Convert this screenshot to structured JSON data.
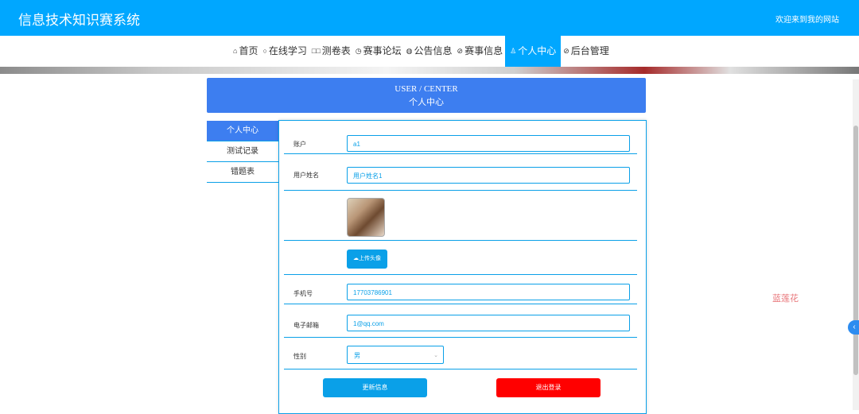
{
  "header": {
    "title": "信息技术知识赛系统",
    "welcome": "欢迎来到我的网站"
  },
  "nav": [
    {
      "icon": "⌂",
      "label": "首页",
      "active": false
    },
    {
      "icon": "○",
      "label": "在线学习",
      "active": false
    },
    {
      "icon": "□□",
      "label": "测卷表",
      "active": false
    },
    {
      "icon": "◷",
      "label": "赛事论坛",
      "active": false
    },
    {
      "icon": "◍",
      "label": "公告信息",
      "active": false
    },
    {
      "icon": "⊘",
      "label": "赛事信息",
      "active": false
    },
    {
      "icon": "♙",
      "label": "个人中心",
      "active": true
    },
    {
      "icon": "⊘",
      "label": "后台管理",
      "active": false
    }
  ],
  "page_header": {
    "en": "USER / CENTER",
    "cn": "个人中心"
  },
  "sidemenu": [
    {
      "label": "个人中心",
      "active": true
    },
    {
      "label": "测试记录",
      "active": false
    },
    {
      "label": "错题表",
      "active": false
    }
  ],
  "form": {
    "account": {
      "label": "账户",
      "value": "a1"
    },
    "name": {
      "label": "用户姓名",
      "value": "用户姓名1"
    },
    "upload_label": "上传头像",
    "phone": {
      "label": "手机号",
      "value": "17703786901"
    },
    "email": {
      "label": "电子邮箱",
      "value": "1@qq.com"
    },
    "gender": {
      "label": "性别",
      "value": "男"
    },
    "update_btn": "更新信息",
    "logout_btn": "退出登录"
  },
  "watermark": "蓝莲花",
  "colors": {
    "primary": "#00a7ff",
    "header_box": "#3d7ef0",
    "logout": "#ff0000"
  }
}
